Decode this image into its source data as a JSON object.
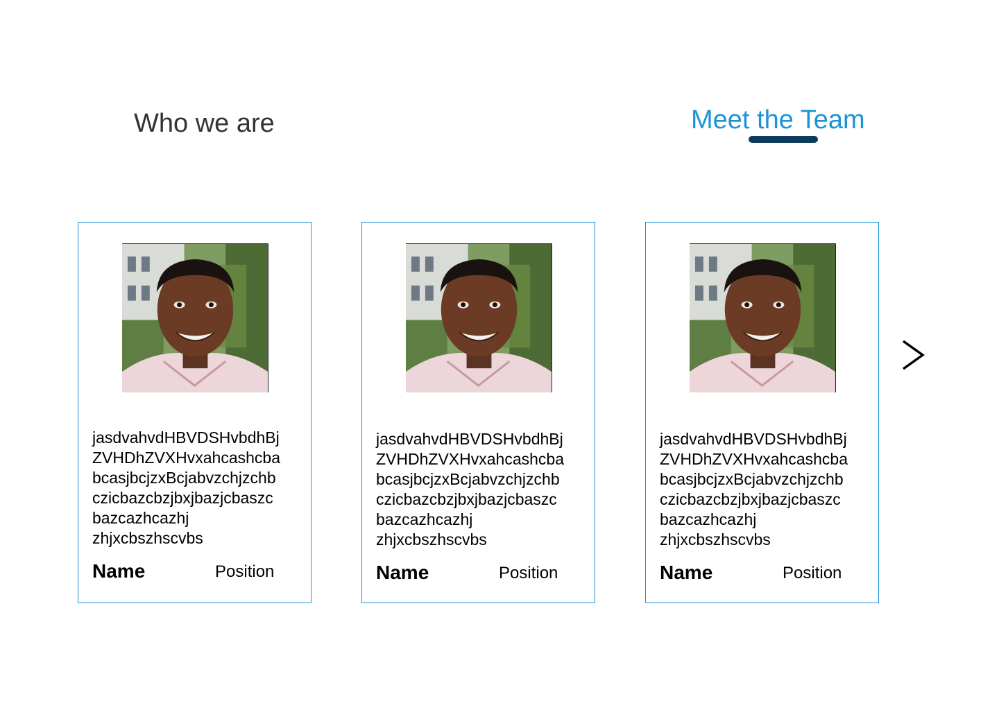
{
  "tabs": {
    "who_we_are": "Who we are",
    "meet_the_team": "Meet the Team",
    "active": "meet_the_team",
    "accent_color": "#1a94d4",
    "underline_color": "#0d3b5c"
  },
  "team": [
    {
      "bio": "jasdvahvdHBVDSHvbdhBj\nZVHDhZVXHvxahcashcba\nbcasjbcjzxBcjabvzchjzchb\nczicbazcbzjbxjbazjcbaszc\nbazcazhcazhj\nzhjxcbszhscvbs",
      "name": "Name",
      "position": "Position",
      "photo": "team-member-photo"
    },
    {
      "bio": "jasdvahvdHBVDSHvbdhBj\nZVHDhZVXHvxahcashcba\nbcasjbcjzxBcjabvzchjzchb\nczicbazcbzjbxjbazjcbaszc\nbazcazhcazhj\nzhjxcbszhscvbs",
      "name": "Name",
      "position": "Position",
      "photo": "team-member-photo"
    },
    {
      "bio": "jasdvahvdHBVDSHvbdhBj\nZVHDhZVXHvxahcashcba\nbcasjbcjzxBcjabvzchjzchb\nczicbazcbzjbxjbazjcbaszc\nbazcazhcazhj\nzhjxcbszhscvbs",
      "name": "Name",
      "position": "Position",
      "photo": "team-member-photo"
    }
  ],
  "carousel": {
    "next_icon": "chevron-right-icon"
  }
}
